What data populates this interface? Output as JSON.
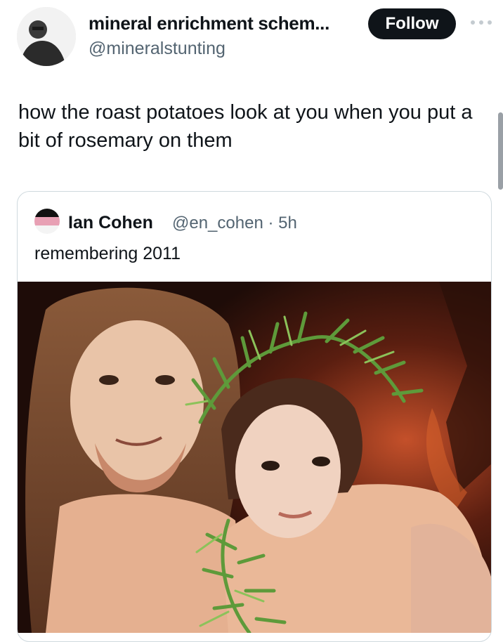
{
  "post": {
    "display_name": "mineral enrichment schem...",
    "handle": "@mineralstunting",
    "follow_label": "Follow",
    "more_icon": "more-horizontal-icon",
    "text": "how the roast potatoes look at you when you put a bit of rosemary on them"
  },
  "quoted_post": {
    "display_name": "Ian Cohen",
    "handle_time": "@en_cohen · 5h",
    "text": "remembering 2011",
    "media": "photo-two-people-with-leafy-wreath"
  }
}
